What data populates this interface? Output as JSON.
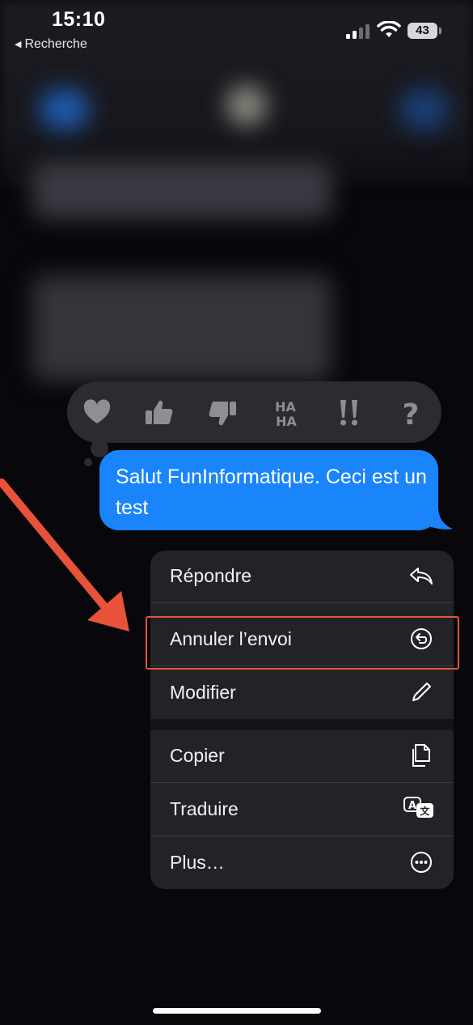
{
  "status_bar": {
    "time": "15:10",
    "back_label": "Recherche",
    "battery": "43"
  },
  "message": {
    "text": "Salut FunInformatique. Ceci est un test",
    "bubble_color": "#1a84fb"
  },
  "tapbacks": [
    "heart-icon",
    "thumbs-up-icon",
    "thumbs-down-icon",
    "haha-icon",
    "exclamation-icon",
    "question-icon"
  ],
  "menu": {
    "items": [
      {
        "label": "Répondre",
        "icon": "reply-icon"
      },
      {
        "label": "Annuler l’envoi",
        "icon": "undo-send-icon"
      },
      {
        "label": "Modifier",
        "icon": "pencil-icon"
      },
      {
        "label": "Copier",
        "icon": "copy-icon"
      },
      {
        "label": "Traduire",
        "icon": "translate-icon"
      },
      {
        "label": "Plus…",
        "icon": "more-icon"
      }
    ]
  },
  "colors": {
    "annotation": "#e8523a",
    "menu_bg": "#232327"
  }
}
